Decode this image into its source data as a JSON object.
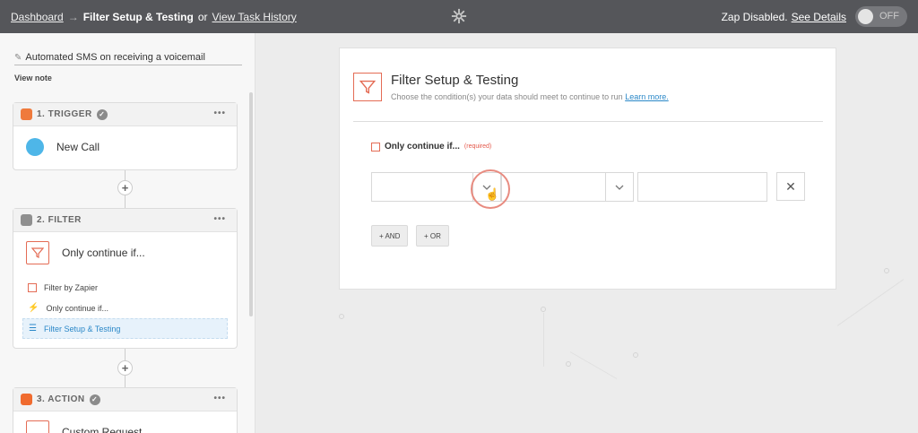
{
  "topbar": {
    "dashboard": "Dashboard",
    "arrow": "→",
    "current": "Filter Setup & Testing",
    "or": "or",
    "history": "View Task History",
    "status": "Zap Disabled.",
    "see_details": "See Details",
    "toggle": "OFF"
  },
  "sidebar": {
    "zap_name": "Automated SMS on receiving a voicemail",
    "view_note": "View note",
    "steps": [
      {
        "header": "1. TRIGGER",
        "title": "New Call"
      },
      {
        "header": "2. FILTER",
        "title": "Only continue if...",
        "subitems": [
          "Filter by Zapier",
          "Only continue if...",
          "Filter Setup & Testing"
        ]
      },
      {
        "header": "3. ACTION",
        "title": "Custom Request"
      }
    ],
    "more": "•••",
    "plus": "+"
  },
  "panel": {
    "title": "Filter Setup & Testing",
    "subtitle": "Choose the condition(s) your data should meet to continue to run",
    "learn_more": "Learn more.",
    "only_label": "Only continue if...",
    "required": "(required)",
    "and_button": "+ AND",
    "or_button": "+ OR",
    "remove": "✕"
  },
  "colors": {
    "topbar": "#55565a",
    "accent_red": "#e46c55",
    "link_blue": "#2b88c8"
  }
}
